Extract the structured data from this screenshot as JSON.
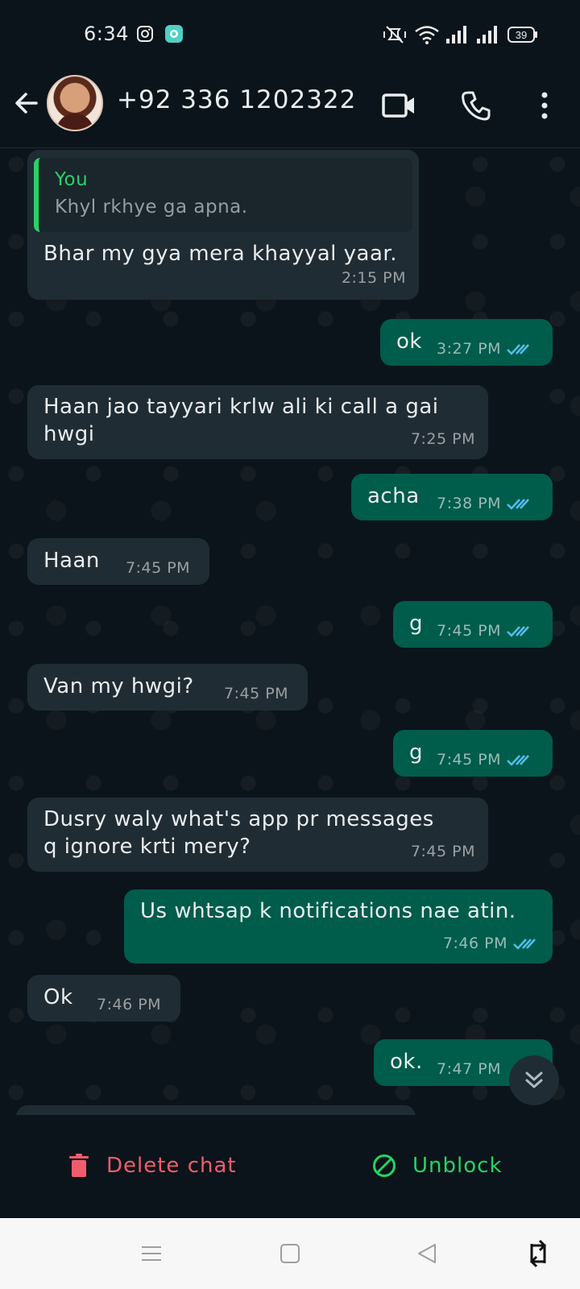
{
  "status_bar": {
    "time": "6:34",
    "battery": "39"
  },
  "header": {
    "contact_name": "+92 336 1202322"
  },
  "messages": [
    {
      "dir": "in",
      "quote_author": "You",
      "quote_text": "Khyl rkhye ga apna.",
      "text": "Bhar my gya mera khayyal yaar.",
      "time": "2:15 PM"
    },
    {
      "dir": "out",
      "text": "ok",
      "time": "3:27 PM"
    },
    {
      "dir": "in",
      "text_line1": "Haan jao tayyari krlw ali ki call a gai",
      "text_line2": "hwgi",
      "time": "7:25 PM"
    },
    {
      "dir": "out",
      "text": "acha",
      "time": "7:38 PM"
    },
    {
      "dir": "in",
      "text": "Haan",
      "time": "7:45 PM"
    },
    {
      "dir": "out",
      "text": "g",
      "time": "7:45 PM"
    },
    {
      "dir": "in",
      "text": "Van my hwgi?",
      "time": "7:45 PM"
    },
    {
      "dir": "out",
      "text": "g",
      "time": "7:45 PM"
    },
    {
      "dir": "in",
      "text_line1": "Dusry waly what's app pr messages",
      "text_line2": "q ignore krti mery?",
      "time": "7:45 PM"
    },
    {
      "dir": "out",
      "text": "Us whtsap k notifications nae atin.",
      "time": "7:46 PM"
    },
    {
      "dir": "in",
      "text": "Ok",
      "time": "7:46 PM"
    },
    {
      "dir": "out",
      "text": "ok.",
      "time": "7:47 PM"
    }
  ],
  "bottom_bar": {
    "delete_label": "Delete chat",
    "unblock_label": "Unblock"
  },
  "colors": {
    "outgoing_bubble": "#005c4b",
    "incoming_bubble": "#202c33",
    "delete": "#f15c6d",
    "unblock": "#25d366",
    "read_ticks": "#53bdeb"
  },
  "icons": [
    "instagram-icon",
    "app-notification-icon",
    "mute-icon",
    "wifi-icon",
    "signal-icon",
    "battery-icon",
    "back-arrow-icon",
    "video-call-icon",
    "phone-icon",
    "more-icon",
    "double-check-icon",
    "scroll-down-icon",
    "trash-icon",
    "block-icon",
    "menu-icon",
    "home-icon",
    "back-icon",
    "rotate-icon"
  ]
}
